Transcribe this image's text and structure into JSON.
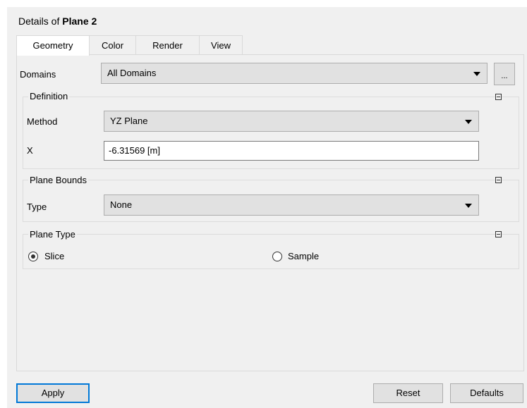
{
  "header": {
    "prefix": "Details of",
    "object": "Plane 2"
  },
  "tabs": [
    {
      "label": "Geometry",
      "active": true
    },
    {
      "label": "Color"
    },
    {
      "label": "Render"
    },
    {
      "label": "View"
    }
  ],
  "domains": {
    "label": "Domains",
    "value": "All Domains",
    "more_button": "..."
  },
  "definition": {
    "title": "Definition",
    "method_label": "Method",
    "method_value": "YZ Plane",
    "x_label": "X",
    "x_value": "-6.31569 [m]"
  },
  "plane_bounds": {
    "title": "Plane Bounds",
    "type_label": "Type",
    "type_value": "None"
  },
  "plane_type": {
    "title": "Plane Type",
    "options": [
      {
        "label": "Slice",
        "selected": true
      },
      {
        "label": "Sample",
        "selected": false
      }
    ]
  },
  "footer": {
    "apply": "Apply",
    "reset": "Reset",
    "defaults": "Defaults"
  },
  "colors": {
    "accent": "#0078d7",
    "panel_bg": "#f0f0f0",
    "control_bg": "#e1e1e1"
  }
}
